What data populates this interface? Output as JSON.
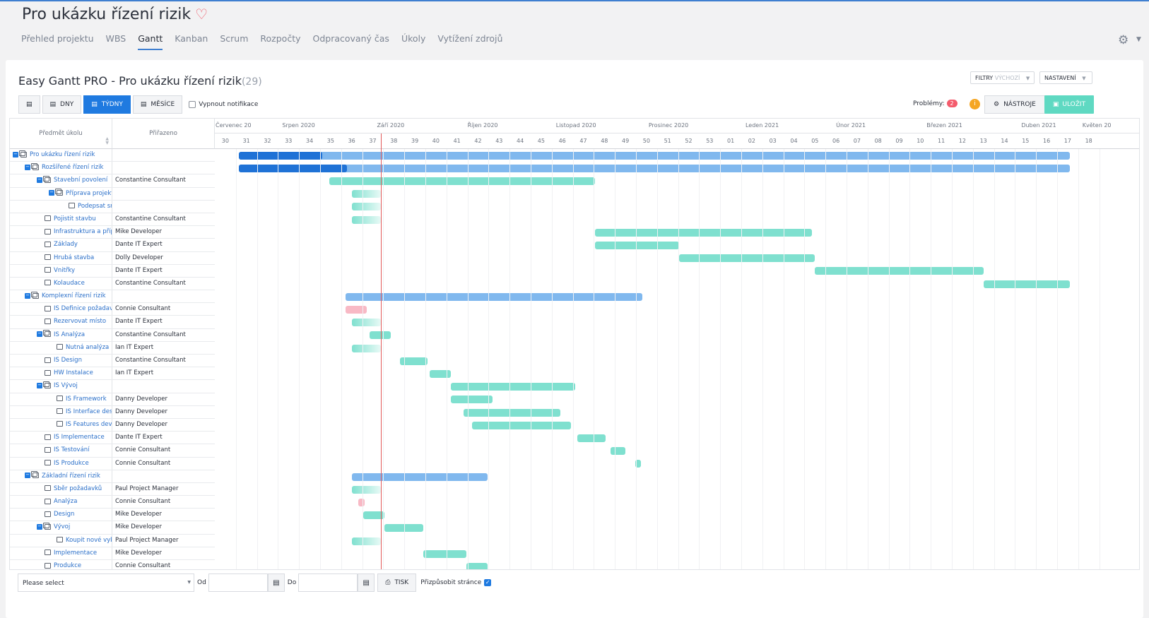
{
  "project": {
    "title": "Pro ukázku řízení rizik",
    "heart_icon": "heart-icon"
  },
  "nav": {
    "tabs": [
      {
        "label": "Přehled projektu",
        "active": false
      },
      {
        "label": "WBS",
        "active": false
      },
      {
        "label": "Gantt",
        "active": true
      },
      {
        "label": "Kanban",
        "active": false
      },
      {
        "label": "Scrum",
        "active": false
      },
      {
        "label": "Rozpočty",
        "active": false
      },
      {
        "label": "Odpracovaný čas",
        "active": false
      },
      {
        "label": "Úkoly",
        "active": false
      },
      {
        "label": "Vytížení zdrojů",
        "active": false
      }
    ]
  },
  "gantt": {
    "title": "Easy Gantt PRO - Pro ukázku řízení rizik",
    "count": "(29)",
    "filters_label": "FILTRY",
    "filters_value": "VÝCHOZÍ",
    "settings_label": "NASTAVENÍ"
  },
  "toolbar": {
    "days": "DNY",
    "weeks": "TÝDNY",
    "months": "MĚSÍCE",
    "notify": "Vypnout notifikace",
    "problems_label": "Problémy:",
    "problems_count": "2",
    "info_badge": "i",
    "tools": "NÁSTROJE",
    "save": "ULOŽIT"
  },
  "columns": {
    "subject": "Předmět úkolu",
    "assigned": "Přiřazeno"
  },
  "timeline": {
    "months": [
      "Červenec 20",
      "Srpen 2020",
      "Září 2020",
      "Říjen 2020",
      "Listopad 2020",
      "Prosinec 2020",
      "Leden 2021",
      "Únor 2021",
      "Březen 2021",
      "Duben 2021",
      "Květen 20"
    ],
    "weeks": [
      "30",
      "31",
      "32",
      "33",
      "34",
      "35",
      "36",
      "37",
      "38",
      "39",
      "40",
      "41",
      "42",
      "43",
      "44",
      "45",
      "46",
      "47",
      "48",
      "49",
      "50",
      "51",
      "52",
      "53",
      "01",
      "02",
      "03",
      "04",
      "05",
      "06",
      "07",
      "08",
      "09",
      "10",
      "11",
      "12",
      "13",
      "14",
      "15",
      "16",
      "17",
      "18"
    ]
  },
  "rows": [
    {
      "subject": "Pro ukázku řízení rizik",
      "assigned": "",
      "level": 0,
      "toggle": true,
      "type": "project",
      "bar": {
        "kind": "parent",
        "start": 1.15,
        "end": 40.6,
        "progress": 0.1
      }
    },
    {
      "subject": "Rozšířené řízení rizik",
      "assigned": "",
      "level": 1,
      "toggle": true,
      "type": "project",
      "bar": {
        "kind": "parent",
        "start": 1.15,
        "end": 40.6,
        "progress": 0.13
      }
    },
    {
      "subject": "Stavební povolení",
      "assigned": "Constantine Consultant",
      "level": 2,
      "toggle": true,
      "type": "project",
      "bar": {
        "kind": "task",
        "start": 5.45,
        "end": 18.05
      }
    },
    {
      "subject": "Příprava projektu",
      "assigned": "",
      "level": 3,
      "toggle": true,
      "type": "project",
      "bar": {
        "kind": "fade",
        "start": 6.5,
        "end": 7.9
      }
    },
    {
      "subject": "Podepsat smlouvu",
      "assigned": "",
      "level": 4,
      "toggle": false,
      "type": "task",
      "bar": {
        "kind": "fade",
        "start": 6.5,
        "end": 7.9
      }
    },
    {
      "subject": "Pojistit stavbu",
      "assigned": "Constantine Consultant",
      "level": 2,
      "toggle": false,
      "type": "task",
      "bar": {
        "kind": "fade",
        "start": 6.5,
        "end": 7.9
      }
    },
    {
      "subject": "Infrastruktura a přípojky",
      "assigned": "Mike Developer",
      "level": 2,
      "toggle": false,
      "type": "task",
      "bar": {
        "kind": "task",
        "start": 18.05,
        "end": 28.35
      }
    },
    {
      "subject": "Základy",
      "assigned": "Dante IT Expert",
      "level": 2,
      "toggle": false,
      "type": "task",
      "bar": {
        "kind": "task",
        "start": 18.05,
        "end": 22.05
      }
    },
    {
      "subject": "Hrubá stavba",
      "assigned": "Dolly Developer",
      "level": 2,
      "toggle": false,
      "type": "task",
      "bar": {
        "kind": "task",
        "start": 22.05,
        "end": 28.5
      }
    },
    {
      "subject": "Vnitřky",
      "assigned": "Dante IT Expert",
      "level": 2,
      "toggle": false,
      "type": "task",
      "bar": {
        "kind": "task",
        "start": 28.5,
        "end": 36.5
      }
    },
    {
      "subject": "Kolaudace",
      "assigned": "Constantine Consultant",
      "level": 2,
      "toggle": false,
      "type": "task",
      "bar": {
        "kind": "task",
        "start": 36.5,
        "end": 40.6
      }
    },
    {
      "subject": "Komplexní řízení rizik",
      "assigned": "",
      "level": 1,
      "toggle": true,
      "type": "project",
      "bar": {
        "kind": "parent",
        "start": 6.2,
        "end": 20.3
      }
    },
    {
      "subject": "IS Definice požadavků",
      "assigned": "Connie Consultant",
      "level": 2,
      "toggle": false,
      "type": "task",
      "bar": {
        "kind": "late",
        "start": 6.2,
        "end": 7.2
      }
    },
    {
      "subject": "Rezervovat místo",
      "assigned": "Dante IT Expert",
      "level": 2,
      "toggle": false,
      "type": "task",
      "bar": {
        "kind": "fade",
        "start": 6.5,
        "end": 7.9
      }
    },
    {
      "subject": "IS Analýza",
      "assigned": "Constantine Consultant",
      "level": 2,
      "toggle": true,
      "type": "project",
      "bar": {
        "kind": "task",
        "start": 7.35,
        "end": 8.35
      }
    },
    {
      "subject": "Nutná analýza",
      "assigned": "Ian IT Expert",
      "level": 3,
      "toggle": false,
      "type": "task",
      "bar": {
        "kind": "fade",
        "start": 6.5,
        "end": 7.9
      }
    },
    {
      "subject": "IS Design",
      "assigned": "Constantine Consultant",
      "level": 2,
      "toggle": false,
      "type": "task",
      "bar": {
        "kind": "task",
        "start": 8.8,
        "end": 10.1
      }
    },
    {
      "subject": "HW Instalace",
      "assigned": "Ian IT Expert",
      "level": 2,
      "toggle": false,
      "type": "task",
      "bar": {
        "kind": "task",
        "start": 10.2,
        "end": 11.2
      }
    },
    {
      "subject": "IS Vývoj",
      "assigned": "",
      "level": 2,
      "toggle": true,
      "type": "project",
      "bar": {
        "kind": "task",
        "start": 11.2,
        "end": 17.1
      }
    },
    {
      "subject": "IS Framework",
      "assigned": "Danny Developer",
      "level": 3,
      "toggle": false,
      "type": "task",
      "bar": {
        "kind": "task",
        "start": 11.2,
        "end": 13.2
      }
    },
    {
      "subject": "IS Interface design",
      "assigned": "Danny Developer",
      "level": 3,
      "toggle": false,
      "type": "task",
      "bar": {
        "kind": "task",
        "start": 11.8,
        "end": 16.4
      }
    },
    {
      "subject": "IS Features development",
      "assigned": "Danny Developer",
      "level": 3,
      "toggle": false,
      "type": "task",
      "bar": {
        "kind": "task",
        "start": 12.2,
        "end": 16.9
      }
    },
    {
      "subject": "IS Implementace",
      "assigned": "Dante IT Expert",
      "level": 2,
      "toggle": false,
      "type": "task",
      "bar": {
        "kind": "task",
        "start": 17.2,
        "end": 18.55
      }
    },
    {
      "subject": "IS Testování",
      "assigned": "Connie Consultant",
      "level": 2,
      "toggle": false,
      "type": "task",
      "bar": {
        "kind": "task",
        "start": 18.8,
        "end": 19.5
      }
    },
    {
      "subject": "IS Produkce",
      "assigned": "Connie Consultant",
      "level": 2,
      "toggle": false,
      "type": "task",
      "bar": {
        "kind": "task",
        "start": 19.95,
        "end": 20.25
      }
    },
    {
      "subject": "Základní řízení rizik",
      "assigned": "",
      "level": 1,
      "toggle": true,
      "type": "project",
      "bar": {
        "kind": "parent",
        "start": 6.5,
        "end": 12.95
      }
    },
    {
      "subject": "Sběr požadavků",
      "assigned": "Paul Project Manager",
      "level": 2,
      "toggle": false,
      "type": "task",
      "bar": {
        "kind": "fade",
        "start": 6.5,
        "end": 7.9
      }
    },
    {
      "subject": "Analýza",
      "assigned": "Connie Consultant",
      "level": 2,
      "toggle": false,
      "type": "task",
      "bar": {
        "kind": "late",
        "start": 6.8,
        "end": 7.1
      }
    },
    {
      "subject": "Design",
      "assigned": "Mike Developer",
      "level": 2,
      "toggle": false,
      "type": "task",
      "bar": {
        "kind": "task",
        "start": 7.05,
        "end": 8.05
      }
    },
    {
      "subject": "Vývoj",
      "assigned": "Mike Developer",
      "level": 2,
      "toggle": true,
      "type": "project",
      "bar": {
        "kind": "task",
        "start": 8.05,
        "end": 9.9
      }
    },
    {
      "subject": "Koupit nové vybavení",
      "assigned": "Paul Project Manager",
      "level": 3,
      "toggle": false,
      "type": "task",
      "bar": {
        "kind": "fade",
        "start": 6.5,
        "end": 7.9
      }
    },
    {
      "subject": "Implementace",
      "assigned": "Mike Developer",
      "level": 2,
      "toggle": false,
      "type": "task",
      "bar": {
        "kind": "task",
        "start": 9.9,
        "end": 11.95
      }
    },
    {
      "subject": "Produkce",
      "assigned": "Connie Consultant",
      "level": 2,
      "toggle": false,
      "type": "task",
      "bar": {
        "kind": "task",
        "start": 11.95,
        "end": 12.95
      }
    }
  ],
  "today_week_index": 7.9,
  "footer": {
    "select_placeholder": "Please select",
    "from": "Od",
    "to": "Do",
    "print": "TISK",
    "fit_page": "Přizpůsobit stránce"
  }
}
